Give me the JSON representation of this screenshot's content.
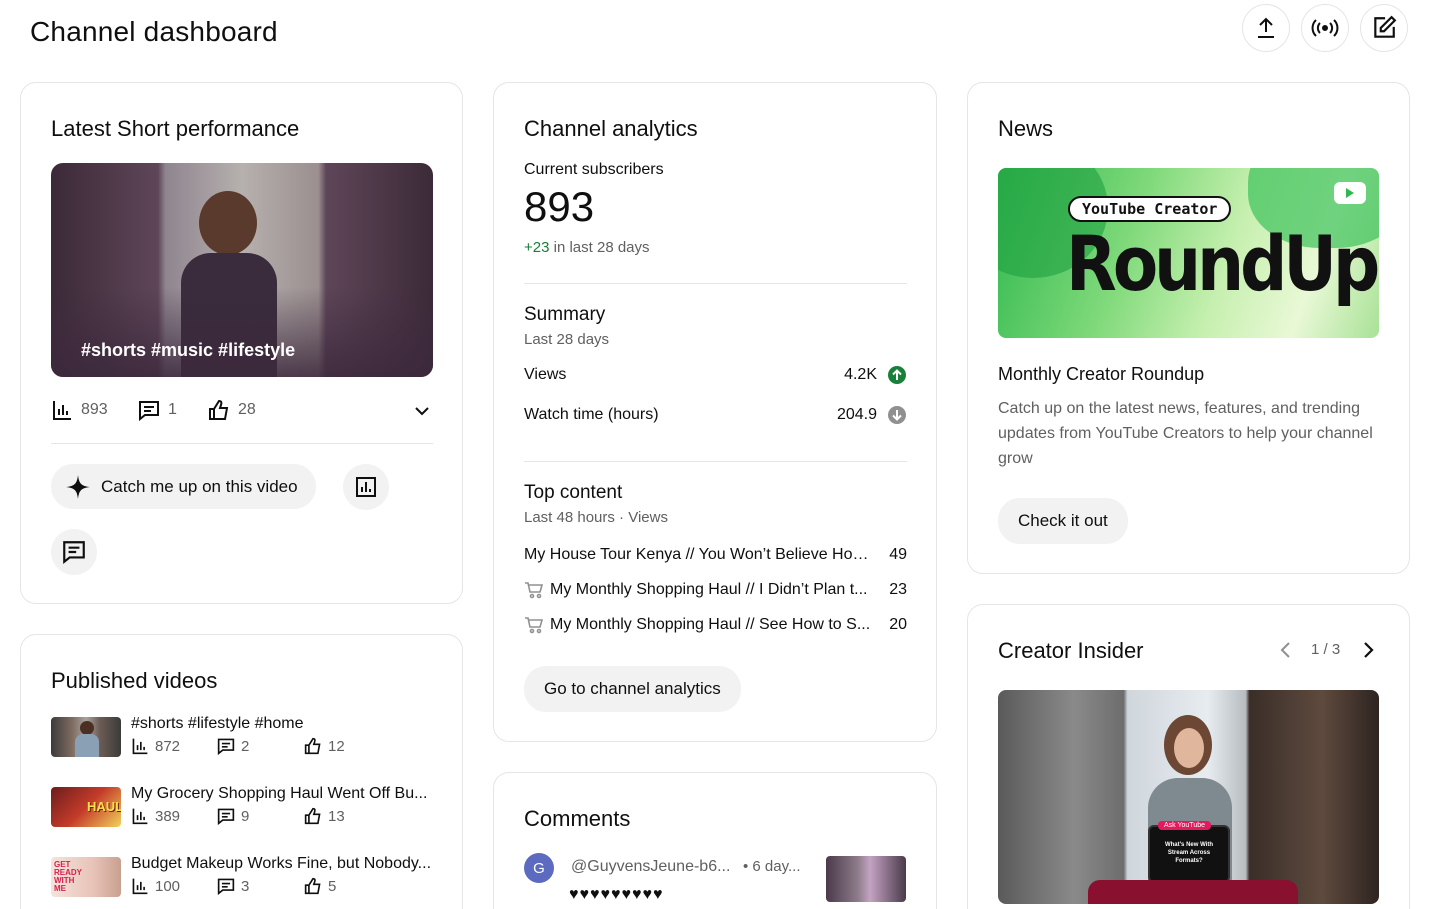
{
  "header": {
    "title": "Channel dashboard",
    "upload_icon": "upload-icon",
    "live_icon": "go-live-icon",
    "create_icon": "create-post-icon"
  },
  "latest_short": {
    "title": "Latest Short performance",
    "overlay_text": "#shorts #music #lifestyle",
    "views": "893",
    "comments": "1",
    "likes": "28",
    "catch_up_label": "Catch me up on this video"
  },
  "published": {
    "title": "Published videos",
    "items": [
      {
        "title": "#shorts #lifestyle #home",
        "views": "872",
        "comments": "2",
        "likes": "12"
      },
      {
        "title": "My Grocery Shopping Haul Went Off Bu...",
        "views": "389",
        "comments": "9",
        "likes": "13",
        "thumb_text": "HAUL"
      },
      {
        "title": "Budget Makeup Works Fine, but Nobody...",
        "views": "100",
        "comments": "3",
        "likes": "5",
        "thumb_text": "GET READY WITH ME"
      }
    ]
  },
  "analytics": {
    "title": "Channel analytics",
    "subs_label": "Current subscribers",
    "subs_value": "893",
    "subs_delta": "+23",
    "subs_delta_suffix": " in last 28 days",
    "summary_title": "Summary",
    "summary_period": "Last 28 days",
    "views_label": "Views",
    "views_value": "4.2K",
    "watch_label": "Watch time (hours)",
    "watch_value": "204.9",
    "top_title": "Top content",
    "top_period": "Last 48 hours · Views",
    "top_items": [
      {
        "title": "My House Tour Kenya // You Won’t Believe How...",
        "value": "49"
      },
      {
        "title": "My Monthly Shopping Haul // I Didn’t Plan t...",
        "value": "23"
      },
      {
        "title": "My Monthly Shopping Haul // See How to S...",
        "value": "20"
      }
    ],
    "go_label": "Go to channel analytics",
    "colors": {
      "up": "#188038",
      "down": "#909090"
    }
  },
  "comments": {
    "title": "Comments",
    "author": "@GuyvensJeune-b6...",
    "time": "• 6 day...",
    "avatar_letter": "G",
    "text": "♥♥♥♥♥♥♥♥♥"
  },
  "news": {
    "title": "News",
    "banner_tag": "YouTube Creator",
    "banner_title": "RoundUp",
    "headline": "Monthly Creator Roundup",
    "body": "Catch up on the latest news, features, and trending updates from YouTube Creators to help your channel grow",
    "cta": "Check it out"
  },
  "insider": {
    "title": "Creator Insider",
    "pager": "1 / 3",
    "sign_top": "Ask YouTube",
    "sign_text": "What's New With Stream Across Formats?"
  }
}
